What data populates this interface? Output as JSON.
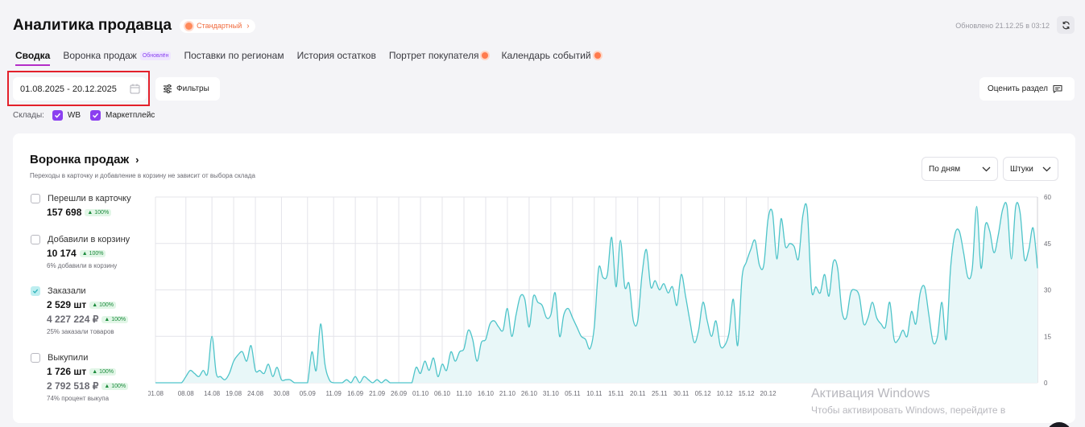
{
  "header": {
    "title": "Аналитика продавца",
    "tier": "Стандартный",
    "updated": "Обновлено 21.12.25 в 03:12"
  },
  "tabs": [
    {
      "label": "Сводка",
      "active": true
    },
    {
      "label": "Воронка продаж",
      "badge": "Обновлён"
    },
    {
      "label": "Поставки по регионам"
    },
    {
      "label": "История остатков"
    },
    {
      "label": "Портрет покупателя",
      "dot": true
    },
    {
      "label": "Календарь событий",
      "dot": true
    }
  ],
  "toolbar": {
    "date_range": "01.08.2025 - 20.12.2025",
    "filters_label": "Фильтры",
    "rate_label": "Оценить раздел"
  },
  "warehouses": {
    "label": "Склады:",
    "items": [
      "WB",
      "Маркетплейс"
    ]
  },
  "card": {
    "title": "Воронка продаж",
    "subtitle": "Переходы в карточку и добавление в корзину не зависит от выбора склада",
    "period_select": "По дням",
    "units_select": "Штуки"
  },
  "metrics": [
    {
      "label": "Перешли в карточку",
      "value": "157 698",
      "change": "100%",
      "checked": false
    },
    {
      "label": "Добавили в корзину",
      "value": "10 174",
      "change": "100%",
      "note": "6% добавили в корзину",
      "checked": false
    },
    {
      "label": "Заказали",
      "value": "2 529 шт",
      "change": "100%",
      "value2": "4 227 224 ₽",
      "change2": "100%",
      "note": "25% заказали товаров",
      "checked": true
    },
    {
      "label": "Выкупили",
      "value": "1 726 шт",
      "change": "100%",
      "value2": "2 792 518 ₽",
      "change2": "100%",
      "note": "74% процент выкупа",
      "checked": false
    }
  ],
  "watermark": {
    "title": "Активация Windows",
    "subtitle": "Чтобы активировать Windows, перейдите в"
  },
  "colors": {
    "accent": "#8b3ff0",
    "line": "#4ec4c9",
    "fill": "#e8f7f8",
    "highlight": "#e3202a"
  },
  "chart_data": {
    "type": "area",
    "series_name": "Заказали",
    "x_tick_labels": [
      "01.08",
      "08.08",
      "14.08",
      "19.08",
      "24.08",
      "30.08",
      "05.09",
      "11.09",
      "16.09",
      "21.09",
      "26.09",
      "01.10",
      "06.10",
      "11.10",
      "16.10",
      "21.10",
      "26.10",
      "31.10",
      "05.11",
      "10.11",
      "15.11",
      "20.11",
      "25.11",
      "30.11",
      "05.12",
      "10.12",
      "15.12",
      "20.12"
    ],
    "y_ticks": [
      0,
      15,
      30,
      45,
      60
    ],
    "ylim": [
      0,
      60
    ],
    "y_axis_side": "right",
    "grid": true,
    "x": [
      "01.08",
      "02.08",
      "03.08",
      "04.08",
      "05.08",
      "06.08",
      "07.08",
      "08.08",
      "09.08",
      "10.08",
      "11.08",
      "12.08",
      "13.08",
      "14.08",
      "15.08",
      "16.08",
      "17.08",
      "18.08",
      "19.08",
      "20.08",
      "21.08",
      "22.08",
      "23.08",
      "24.08",
      "25.08",
      "26.08",
      "27.08",
      "28.08",
      "29.08",
      "30.08",
      "31.08",
      "01.09",
      "02.09",
      "03.09",
      "04.09",
      "05.09",
      "06.09",
      "07.09",
      "08.09",
      "09.09",
      "10.09",
      "11.09",
      "12.09",
      "13.09",
      "14.09",
      "15.09",
      "16.09",
      "17.09",
      "18.09",
      "19.09",
      "20.09",
      "21.09",
      "22.09",
      "23.09",
      "24.09",
      "25.09",
      "26.09",
      "27.09",
      "28.09",
      "29.09",
      "30.09",
      "01.10",
      "02.10",
      "03.10",
      "04.10",
      "05.10",
      "06.10",
      "07.10",
      "08.10",
      "09.10",
      "10.10",
      "11.10",
      "12.10",
      "13.10",
      "14.10",
      "15.10",
      "16.10",
      "17.10",
      "18.10",
      "19.10",
      "20.10",
      "21.10",
      "22.10",
      "23.10",
      "24.10",
      "25.10",
      "26.10",
      "27.10",
      "28.10",
      "29.10",
      "30.10",
      "31.10",
      "01.11",
      "02.11",
      "03.11",
      "04.11",
      "05.11",
      "06.11",
      "07.11",
      "08.11",
      "09.11",
      "10.11",
      "11.11",
      "12.11",
      "13.11",
      "14.11",
      "15.11",
      "16.11",
      "17.11",
      "18.11",
      "19.11",
      "20.11",
      "21.11",
      "22.11",
      "23.11",
      "24.11",
      "25.11",
      "26.11",
      "27.11",
      "28.11",
      "29.11",
      "30.11",
      "01.12",
      "02.12",
      "03.12",
      "04.12",
      "05.12",
      "06.12",
      "07.12",
      "08.12",
      "09.12",
      "10.12",
      "11.12",
      "12.12",
      "13.12",
      "14.12",
      "15.12",
      "16.12",
      "17.12",
      "18.12",
      "19.12",
      "20.12"
    ],
    "values": [
      0,
      0,
      0,
      0,
      0,
      0,
      0,
      2,
      4,
      3,
      2,
      4,
      3,
      15,
      3,
      2,
      1,
      3,
      7,
      9,
      10,
      7,
      12,
      4,
      4,
      3,
      6,
      2,
      5,
      1,
      1,
      1,
      0,
      0,
      0,
      0,
      10,
      4,
      19,
      6,
      1,
      0,
      0,
      0,
      1,
      0,
      2,
      0,
      2,
      1,
      0,
      1,
      0,
      1,
      0,
      0,
      0,
      0,
      0,
      0,
      5,
      3,
      7,
      4,
      8,
      2,
      6,
      4,
      10,
      7,
      10,
      11,
      17,
      14,
      7,
      13,
      14,
      19,
      20,
      18,
      17,
      24,
      15,
      22,
      28,
      27,
      18,
      28,
      26,
      25,
      21,
      22,
      29,
      15,
      22,
      24,
      21,
      18,
      15,
      14,
      11,
      18,
      37,
      34,
      35,
      47,
      31,
      46,
      31,
      32,
      20,
      20,
      35,
      43,
      31,
      33,
      30,
      32,
      29,
      31,
      25,
      35,
      28,
      20,
      13,
      17,
      26,
      20,
      15,
      20,
      12,
      12,
      16,
      27,
      12,
      34,
      39,
      43,
      46,
      38,
      38,
      53,
      55,
      40,
      53,
      44,
      45,
      44,
      40,
      54,
      56,
      30,
      31,
      29,
      35,
      28,
      39,
      37,
      23,
      21,
      29,
      30,
      28,
      19,
      21,
      26,
      21,
      19,
      18,
      26,
      14,
      14,
      17,
      15,
      23,
      19,
      29,
      31,
      22,
      13,
      15,
      26,
      14,
      37,
      48,
      49,
      42,
      34,
      37,
      57,
      37,
      51,
      49,
      42,
      48,
      56,
      57,
      40,
      57,
      55,
      40,
      43,
      50,
      37
    ]
  }
}
